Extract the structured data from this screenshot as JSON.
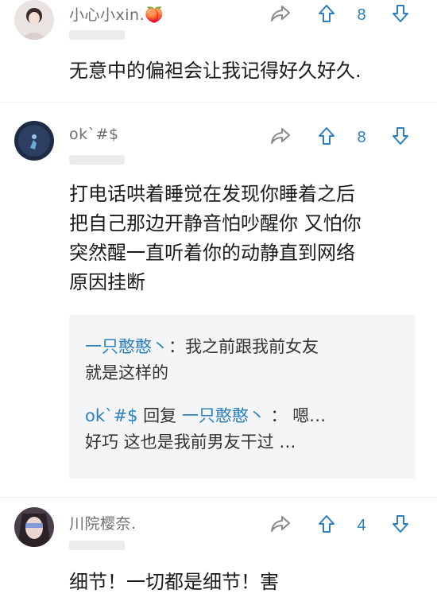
{
  "comments": [
    {
      "username": "小心小xin.",
      "emoji": "🍑",
      "upvotes": "8",
      "text": "无意中的偏袒会让我记得好久好久."
    },
    {
      "username": "ok`#$",
      "upvotes": "8",
      "text": "打电话哄着睡觉在发现你睡着之后\n把自己那边开静音怕吵醒你 又怕你\n突然醒一直听着你的动静直到网络\n原因挂断",
      "replies": [
        {
          "author": "一只憨憨丶",
          "separator": "：",
          "text": "我之前跟我前女友\n就是这样的"
        },
        {
          "author": "ok`#$",
          "mid": " 回复 ",
          "target": "一只憨憨丶",
          "separator": " ： ",
          "text": "嗯…\n好巧 这也是我前男友干过 …"
        }
      ]
    },
    {
      "username": "川院樱奈.",
      "upvotes": "4",
      "text": "细节！一切都是细节！害"
    }
  ],
  "colors": {
    "accent": "#2d7fc0",
    "username": "#6f6f6f",
    "reply_bg": "#f3f5f7"
  },
  "icons": [
    "share-icon",
    "upvote-icon",
    "downvote-icon"
  ]
}
